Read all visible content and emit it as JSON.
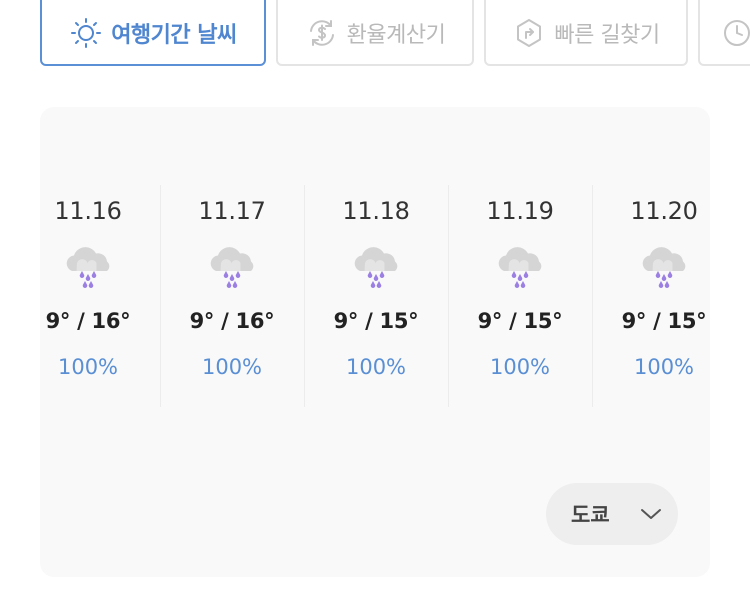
{
  "tabs": [
    {
      "label": "여행기간 날씨",
      "icon": "sun-icon",
      "active": true
    },
    {
      "label": "환율계산기",
      "icon": "currency-exchange-icon",
      "active": false
    },
    {
      "label": "빠른 길찾기",
      "icon": "directions-icon",
      "active": false
    },
    {
      "label": "",
      "icon": "clock-icon",
      "active": false
    }
  ],
  "forecast": [
    {
      "date": "11.16",
      "temp": "9° / 16°",
      "rain": "100%",
      "icon": "rain-cloud-icon"
    },
    {
      "date": "11.17",
      "temp": "9° / 16°",
      "rain": "100%",
      "icon": "rain-cloud-icon"
    },
    {
      "date": "11.18",
      "temp": "9° / 15°",
      "rain": "100%",
      "icon": "rain-cloud-icon"
    },
    {
      "date": "11.19",
      "temp": "9° / 15°",
      "rain": "100%",
      "icon": "rain-cloud-icon"
    },
    {
      "date": "11.20",
      "temp": "9° / 15°",
      "rain": "100%",
      "icon": "rain-cloud-icon"
    }
  ],
  "city_select": {
    "label": "도쿄",
    "icon": "chevron-down-icon"
  },
  "colors": {
    "accent": "#4f86cf",
    "rain_drop": "#9b7fe3",
    "inactive": "#b9b9b9"
  }
}
